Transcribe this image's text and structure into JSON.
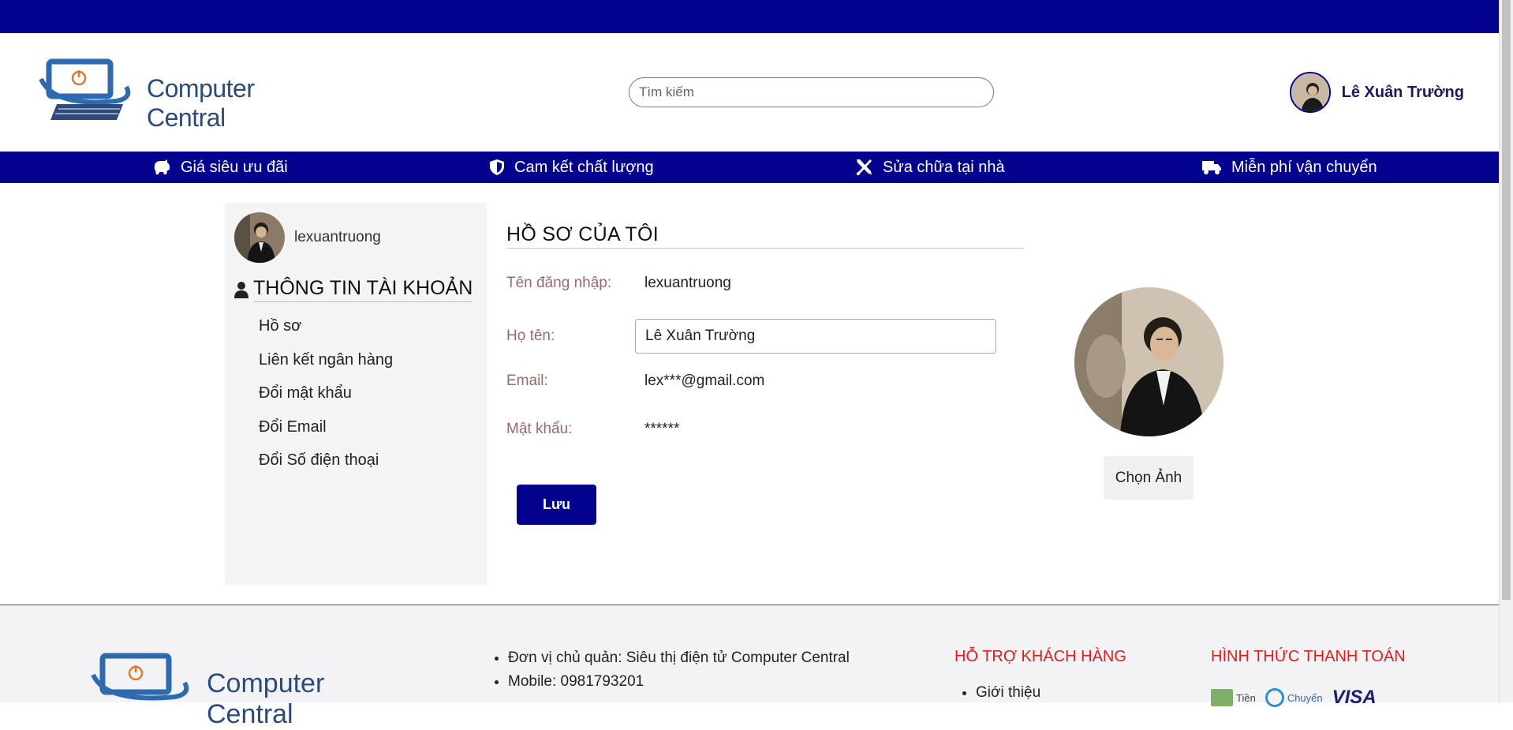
{
  "header": {
    "brand": "Computer Central",
    "search_placeholder": "Tìm kiếm",
    "user_name": "Lê Xuân Trường"
  },
  "nav": {
    "items": [
      {
        "label": "Giá siêu ưu đãi",
        "icon": "piggy-bank-icon"
      },
      {
        "label": "Cam kết chất lượng",
        "icon": "shield-icon"
      },
      {
        "label": "Sửa chữa tại nhà",
        "icon": "tools-icon"
      },
      {
        "label": "Miễn phí vận chuyển",
        "icon": "truck-icon"
      }
    ]
  },
  "sidebar": {
    "username": "lexuantruong",
    "section_title": "THÔNG TIN TÀI KHOẢN",
    "items": [
      {
        "label": "Hồ sơ"
      },
      {
        "label": "Liên kết ngân hàng"
      },
      {
        "label": "Đổi mật khẩu"
      },
      {
        "label": "Đổi Email"
      },
      {
        "label": "Đổi Số điện thoại"
      }
    ]
  },
  "profile": {
    "title": "HỒ SƠ CỦA TÔI",
    "username_label": "Tên đăng nhập:",
    "username_value": "lexuantruong",
    "fullname_label": "Họ tên:",
    "fullname_value": "Lê Xuân Trường",
    "email_label": "Email:",
    "email_value": "lex***@gmail.com",
    "password_label": "Mật khẩu:",
    "password_value": "******",
    "save_label": "Lưu",
    "choose_photo_label": "Chọn Ảnh"
  },
  "footer": {
    "brand": "Computer Central",
    "info": [
      "Đơn vị chủ quản: Siêu thị điện tử Computer Central",
      "Mobile: 0981793201"
    ],
    "support_title": "HỖ TRỢ KHÁCH HÀNG",
    "support_items": [
      "Giới thiệu"
    ],
    "payment_title": "HÌNH THỨC THANH TOÁN",
    "payment_methods": [
      "Tiền",
      "Chuyển",
      "VISA"
    ]
  },
  "colors": {
    "primary": "#02028f",
    "label": "#9a6a6a",
    "footer_heading": "#e21b1b"
  }
}
